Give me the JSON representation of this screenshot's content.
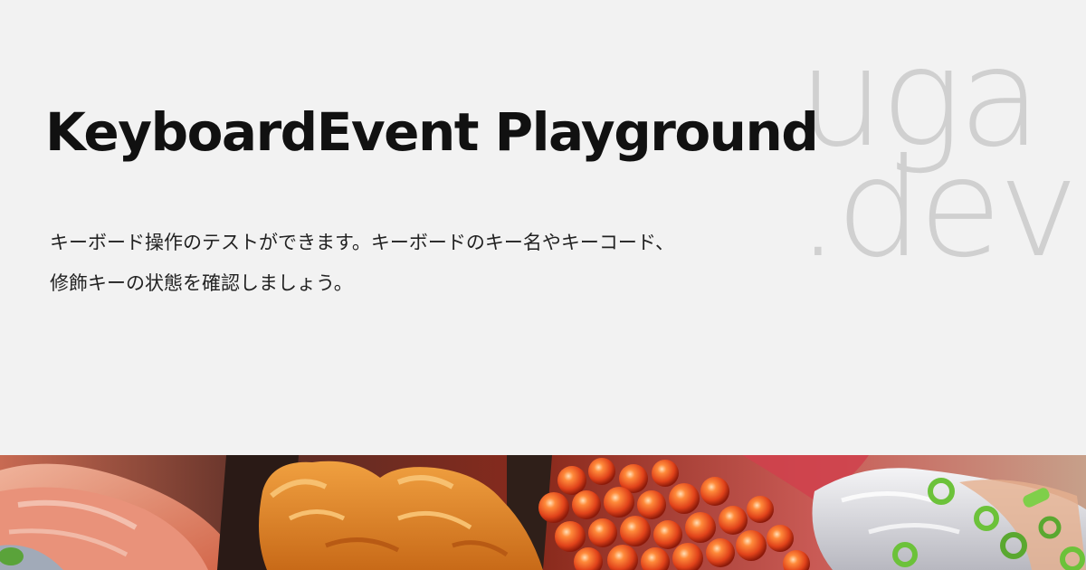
{
  "title": "KeyboardEvent Playground",
  "description": {
    "line1": "キーボード操作のテストができます。キーボードのキー名やキーコード、",
    "line2": "修飾キーの状態を確認しましょう。"
  },
  "watermark": {
    "line1": "uga",
    "line2": ".dev"
  },
  "colors": {
    "background": "#f2f2f2",
    "title": "#111111",
    "text": "#222222",
    "watermark": "#d0d0d0"
  }
}
